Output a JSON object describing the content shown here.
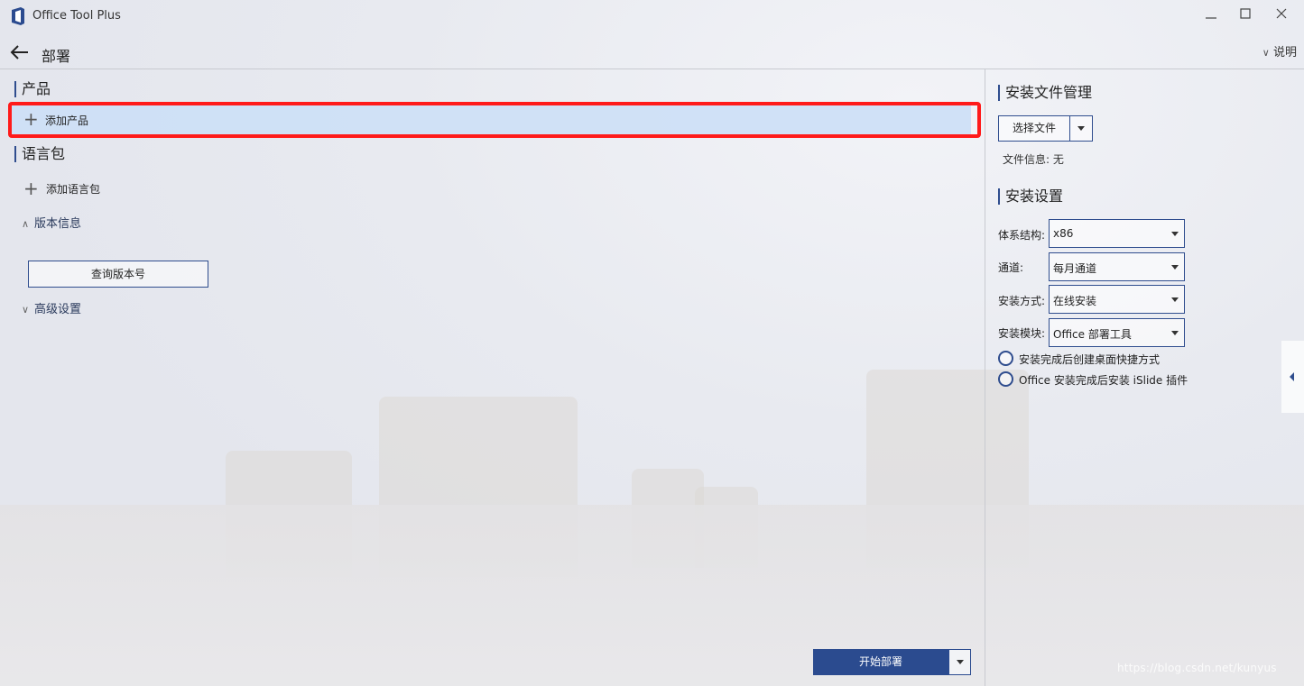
{
  "window": {
    "app_title": "Office Tool Plus",
    "minimize_icon": "minimize-icon",
    "maximize_icon": "maximize-icon",
    "close_icon": "close-icon"
  },
  "nav": {
    "back_icon": "arrow-left-icon",
    "page_title": "部署",
    "help_label": "说明"
  },
  "left": {
    "products_title": "产品",
    "add_product_label": "添加产品",
    "lang_title": "语言包",
    "add_lang_label": "添加语言包",
    "version_info_label": "版本信息",
    "query_version_label": "查询版本号",
    "advanced_label": "高级设置",
    "start_deploy_label": "开始部署"
  },
  "right": {
    "file_mgmt_title": "安装文件管理",
    "choose_file_label": "选择文件",
    "file_info_label": "文件信息:",
    "file_info_value": "无",
    "settings_title": "安装设置",
    "arch_label": "体系结构:",
    "arch_value": "x86",
    "channel_label": "通道:",
    "channel_value": "每月通道",
    "install_method_label": "安装方式:",
    "install_method_value": "在线安装",
    "install_module_label": "安装模块:",
    "install_module_value": "Office 部署工具",
    "option_desktop_shortcut": "安装完成后创建桌面快捷方式",
    "option_islide": "Office 安装完成后安装 iSlide 插件"
  },
  "watermark": "https://blog.csdn.net/kunyus",
  "colors": {
    "accent": "#2b4b8f",
    "highlight_border": "#ff1a1a",
    "selected_row": "#cde0f6"
  }
}
